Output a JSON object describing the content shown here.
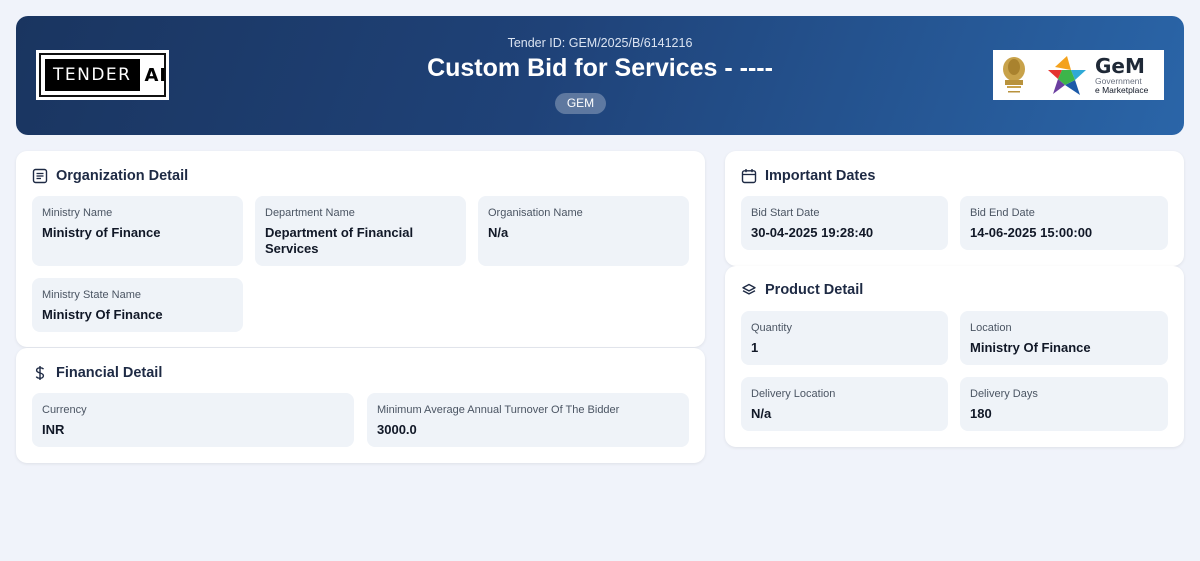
{
  "header": {
    "brand_word": "TENDER",
    "brand_ai": "AI",
    "tender_id": "Tender ID: GEM/2025/B/6141216",
    "title": "Custom Bid for Services - ----",
    "badge": "GEM",
    "gem_logo": {
      "word": "GeM",
      "line1": "Government",
      "line2": "e Marketplace"
    }
  },
  "organization": {
    "title": "Organization Detail",
    "icon": "list-icon",
    "fields": [
      {
        "label": "Ministry Name",
        "value": "Ministry of Finance"
      },
      {
        "label": "Department Name",
        "value": "Department of Financial Services"
      },
      {
        "label": "Organisation Name",
        "value": "N/a"
      },
      {
        "label": "Ministry State Name",
        "value": "Ministry Of Finance"
      }
    ]
  },
  "financial": {
    "title": "Financial Detail",
    "icon": "dollar-icon",
    "fields": [
      {
        "label": "Currency",
        "value": "INR"
      },
      {
        "label": "Minimum Average Annual Turnover Of The Bidder",
        "value": "3000.0"
      }
    ]
  },
  "dates": {
    "title": "Important Dates",
    "icon": "calendar-icon",
    "fields": [
      {
        "label": "Bid Start Date",
        "value": "30-04-2025 19:28:40"
      },
      {
        "label": "Bid End Date",
        "value": "14-06-2025 15:00:00"
      }
    ]
  },
  "product": {
    "title": "Product Detail",
    "icon": "layers-icon",
    "fields": [
      {
        "label": "Quantity",
        "value": "1"
      },
      {
        "label": "Location",
        "value": "Ministry Of Finance"
      },
      {
        "label": "Delivery Location",
        "value": "N/a"
      },
      {
        "label": "Delivery Days",
        "value": "180"
      }
    ]
  },
  "colors": {
    "header_start": "#1a3560",
    "header_end": "#2a65a8",
    "field_bg": "#eff3f8",
    "page_bg": "#f0f3fa"
  }
}
